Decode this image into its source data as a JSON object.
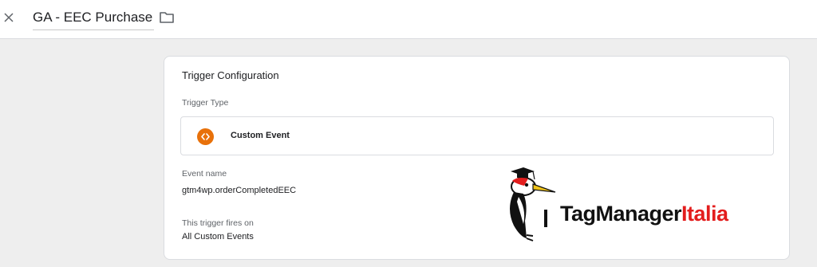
{
  "header": {
    "title": "GA - EEC Purchase",
    "close_icon": "close-icon",
    "folder_icon": "folder-icon"
  },
  "trigger_config": {
    "title": "Trigger Configuration",
    "trigger_type_label": "Trigger Type",
    "trigger_type_value": "Custom Event",
    "trigger_type_icon": "code-icon",
    "event_name_label": "Event name",
    "event_name_value": "gtm4wp.orderCompletedEEC",
    "fires_on_label": "This trigger fires on",
    "fires_on_value": "All Custom Events"
  },
  "watermark": {
    "brand_dark": "TagManager",
    "brand_red": "Italia"
  },
  "colors": {
    "accent_orange": "#e8710a",
    "brand_red": "#e31d1d"
  }
}
